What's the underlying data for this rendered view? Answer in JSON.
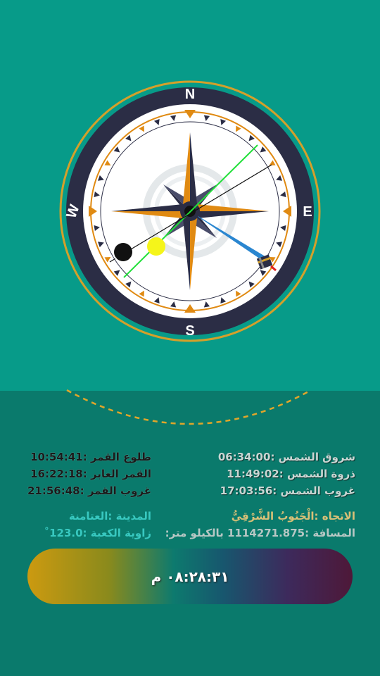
{
  "compass": {
    "north": "N",
    "south": "S",
    "east": "E",
    "west": "W"
  },
  "sun": {
    "sunrise": "شروق الشمس :06:34:00",
    "zenith": "ذروة الشمس :11:49:02",
    "sunset": "غروب الشمس :17:03:56"
  },
  "moon": {
    "moonrise": "طلوع القمر :10:54:41",
    "transit": "القمر العابر :16:22:18",
    "moonset": "غروب القمر :21:56:48"
  },
  "location": {
    "direction": "الاتجاه :الْجَنُوبُ الشَّرْقِيُّ",
    "distance": "المسافة :1114271.875 بالكيلو متر:",
    "city": "المدينة :العتامنة",
    "kaaba_angle": "زاوية الكعبة :123.0˚"
  },
  "clock": {
    "time": "٠٨:٢٨:٣١ م"
  },
  "colors": {
    "top_bg": "#079b89",
    "bottom_bg": "#0a7a6c",
    "ring_dark": "#2b2d45",
    "accent_orange": "#e08a12",
    "needle_blue": "#2a86d0",
    "qibla_green": "#22e03a"
  },
  "icons": {
    "kaaba": "kaaba-icon",
    "sun": "sun-icon",
    "moon": "moon-icon"
  }
}
